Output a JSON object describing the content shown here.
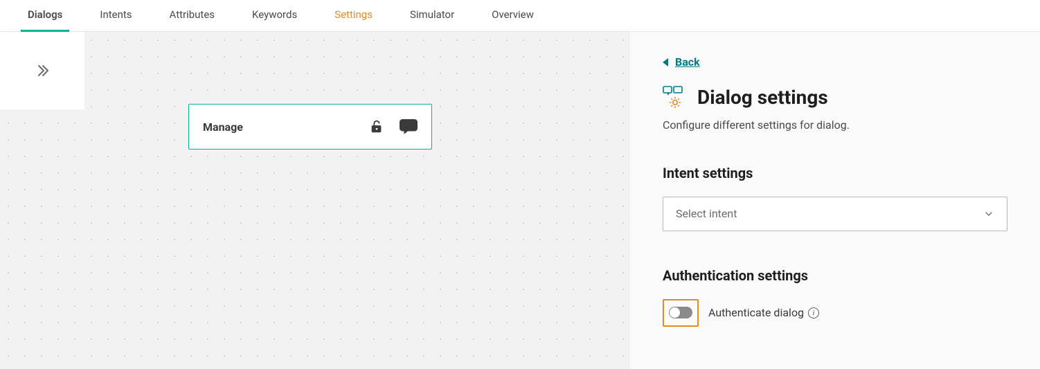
{
  "tabs": {
    "dialogs": "Dialogs",
    "intents": "Intents",
    "attributes": "Attributes",
    "keywords": "Keywords",
    "settings": "Settings",
    "simulator": "Simulator",
    "overview": "Overview"
  },
  "canvas": {
    "node_title": "Manage"
  },
  "panel": {
    "back_label": "Back",
    "title": "Dialog settings",
    "subtitle": "Configure different settings for dialog.",
    "intent_section_title": "Intent settings",
    "intent_placeholder": "Select intent",
    "auth_section_title": "Authentication settings",
    "auth_toggle_label": "Authenticate dialog"
  }
}
